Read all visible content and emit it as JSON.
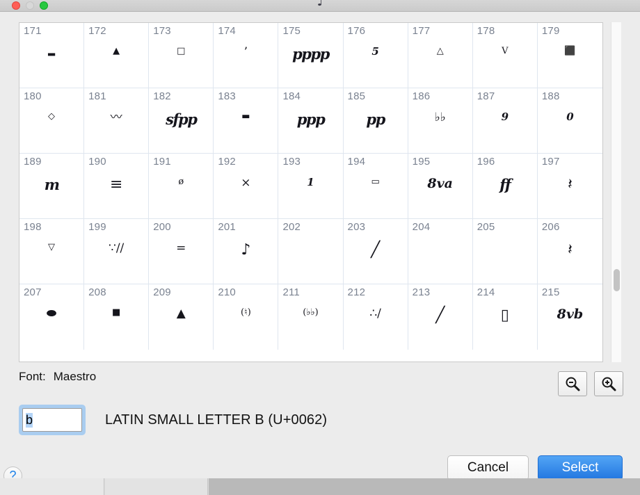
{
  "window": {
    "title_glyph": "♩",
    "traffic_lights": [
      "close",
      "minimize",
      "zoom"
    ]
  },
  "glyph_grid": {
    "columns": 9,
    "cells": [
      {
        "index": "171",
        "glyph": "▂",
        "style": "g-sm"
      },
      {
        "index": "172",
        "glyph": "▲",
        "style": "g-sm"
      },
      {
        "index": "173",
        "glyph": "□",
        "style": "g-sm"
      },
      {
        "index": "174",
        "glyph": "’",
        "style": "g-md"
      },
      {
        "index": "175",
        "glyph": "pppp",
        "style": "g-dyn"
      },
      {
        "index": "176",
        "glyph": "5",
        "style": "g-num"
      },
      {
        "index": "177",
        "glyph": "△",
        "style": "g-sm"
      },
      {
        "index": "178",
        "glyph": "V",
        "style": "g-sm"
      },
      {
        "index": "179",
        "glyph": "⬛",
        "style": "g-sm"
      },
      {
        "index": "180",
        "glyph": "◇",
        "style": "g-sm"
      },
      {
        "index": "181",
        "glyph": "〰",
        "style": "g-md"
      },
      {
        "index": "182",
        "glyph": "sfpp",
        "style": "g-dyn"
      },
      {
        "index": "183",
        "glyph": "▬",
        "style": "g-sm"
      },
      {
        "index": "184",
        "glyph": "ppp",
        "style": "g-dyn"
      },
      {
        "index": "185",
        "glyph": "pp",
        "style": "g-dyn"
      },
      {
        "index": "186",
        "glyph": "♭♭",
        "style": "g-md"
      },
      {
        "index": "187",
        "glyph": "9",
        "style": "g-num"
      },
      {
        "index": "188",
        "glyph": "0",
        "style": "g-num"
      },
      {
        "index": "189",
        "glyph": "m",
        "style": "g-dyn"
      },
      {
        "index": "190",
        "glyph": "≡",
        "style": "g-lg"
      },
      {
        "index": "191",
        "glyph": "ø",
        "style": "g-sm"
      },
      {
        "index": "192",
        "glyph": "×",
        "style": "g-md"
      },
      {
        "index": "193",
        "glyph": "1",
        "style": "g-num"
      },
      {
        "index": "194",
        "glyph": "▭",
        "style": "g-sm"
      },
      {
        "index": "195",
        "glyph": "8va",
        "style": "g-ott"
      },
      {
        "index": "196",
        "glyph": "ff",
        "style": "g-dyn"
      },
      {
        "index": "197",
        "glyph": "𝄽",
        "style": "g-lg"
      },
      {
        "index": "198",
        "glyph": "▽",
        "style": "g-sm"
      },
      {
        "index": "199",
        "glyph": "∵∕∕",
        "style": "g-md"
      },
      {
        "index": "200",
        "glyph": "=",
        "style": "g-md"
      },
      {
        "index": "201",
        "glyph": "♪",
        "style": "g-lg"
      },
      {
        "index": "202",
        "glyph": "",
        "style": "g-sm"
      },
      {
        "index": "203",
        "glyph": "╱",
        "style": "g-lg"
      },
      {
        "index": "204",
        "glyph": "",
        "style": "g-sm"
      },
      {
        "index": "205",
        "glyph": "",
        "style": "g-sm"
      },
      {
        "index": "206",
        "glyph": "𝄽",
        "style": "g-lg"
      },
      {
        "index": "207",
        "glyph": "⬬",
        "style": "g-md"
      },
      {
        "index": "208",
        "glyph": "■",
        "style": "g-sm"
      },
      {
        "index": "209",
        "glyph": "▲",
        "style": "g-md"
      },
      {
        "index": "210",
        "glyph": "(♮)",
        "style": "g-sm"
      },
      {
        "index": "211",
        "glyph": "(♭♭)",
        "style": "g-sm"
      },
      {
        "index": "212",
        "glyph": "∴∕",
        "style": "g-md"
      },
      {
        "index": "213",
        "glyph": "╱",
        "style": "g-lg"
      },
      {
        "index": "214",
        "glyph": "▯",
        "style": "g-lg"
      },
      {
        "index": "215",
        "glyph": "8vb",
        "style": "g-ott"
      }
    ]
  },
  "font_row": {
    "label": "Font:",
    "value": "Maestro"
  },
  "zoom_controls": {
    "zoom_out_title": "Zoom Out",
    "zoom_in_title": "Zoom In"
  },
  "code_row": {
    "input_value": "b",
    "input_placeholder": "",
    "description": "LATIN SMALL LETTER B (U+0062)"
  },
  "footer": {
    "help_label": "?",
    "cancel_label": "Cancel",
    "select_label": "Select"
  },
  "colors": {
    "accent": "#2176e0",
    "selection": "#b3d4f7",
    "focus_ring": "#a9cdf0",
    "grid_line": "#dfe6ef",
    "index_text": "#7a8290"
  }
}
